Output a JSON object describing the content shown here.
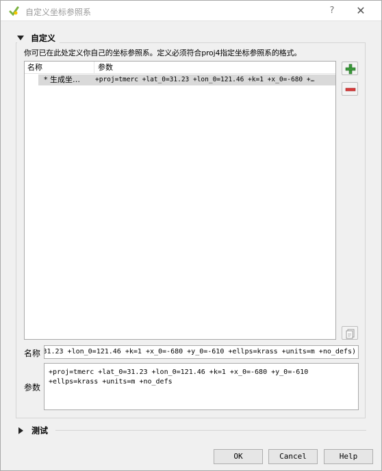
{
  "window": {
    "title": "自定义坐标参照系",
    "help_glyph": "?",
    "close_glyph": "✕"
  },
  "custom_section": {
    "header": "自定义",
    "description": "你可已在此处定义你自己的坐标参照系。定义必须符合proj4指定坐标参照系的格式。",
    "table": {
      "columns": [
        "名称",
        "参数"
      ],
      "rows": [
        {
          "name": "* 生成坐…",
          "params": "+proj=tmerc +lat_0=31.23 +lon_0=121.46 +k=1 +x_0=-680 +…"
        }
      ]
    },
    "name_label": "名称",
    "name_value": "31.23 +lon_0=121.46 +k=1 +x_0=-680 +y_0=-610 +ellps=krass +units=m +no_defs)",
    "params_label": "参数",
    "params_value": "+proj=tmerc +lat_0=31.23 +lon_0=121.46 +k=1 +x_0=-680 +y_0=-610\n+ellps=krass +units=m +no_defs"
  },
  "test_section": {
    "header": "测试"
  },
  "buttons": {
    "ok": "OK",
    "cancel": "Cancel",
    "help": "Help"
  },
  "colors": {
    "add_icon": "#3a9a3a",
    "remove_icon": "#d83a3a",
    "selected_row": "#d9d9d9"
  },
  "icons": {
    "app": "qgis-icon",
    "add": "plus-icon",
    "remove": "minus-icon",
    "copy": "copy-icon"
  }
}
